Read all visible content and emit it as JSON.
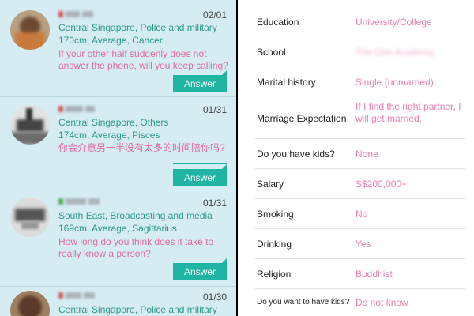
{
  "messages": [
    {
      "date": "02/01",
      "location": "Central Singapore, Police and military",
      "attributes": "170cm, Average, Cancer",
      "question": "If your other half suddenly does not answer the phone, will you keep calling?",
      "action_label": "Answer"
    },
    {
      "date": "01/31",
      "location": "Central Singapore, Others",
      "attributes": "174cm, Average, Pisces",
      "question": "你会介意另一半没有太多的时间陪你吗?",
      "action_label": "Answer"
    },
    {
      "date": "01/31",
      "location": "South East, Broadcasting and media",
      "attributes": "169cm, Average, Sagittarius",
      "question": "How long do you think does it take to really know a person?",
      "action_label": "Answer"
    },
    {
      "date": "01/30",
      "location": "Central Singapore, Police and military"
    }
  ],
  "profile": {
    "rows": [
      {
        "label": "Education",
        "value": "University/College"
      },
      {
        "label": "School",
        "value": "The One Academy"
      },
      {
        "label": "Marital history",
        "value": "Single (unmarried)"
      },
      {
        "label": "Marriage Expectation",
        "value": "If I find the right partner, I will get married."
      },
      {
        "label": "Do you have kids?",
        "value": "None"
      },
      {
        "label": "Salary",
        "value": "S$200,000+"
      },
      {
        "label": "Smoking",
        "value": "No"
      },
      {
        "label": "Drinking",
        "value": "Yes"
      },
      {
        "label": "Religion",
        "value": "Buddhist"
      },
      {
        "label": "Do you want to have kids?",
        "value": "Do not know"
      }
    ]
  },
  "colors": {
    "teal_text": "#2a9a8c",
    "pink_text": "#e06aa0",
    "answer_button": "#1fb5a2",
    "left_bg": "#d6ecf3",
    "profile_value": "#ea7fb0"
  }
}
